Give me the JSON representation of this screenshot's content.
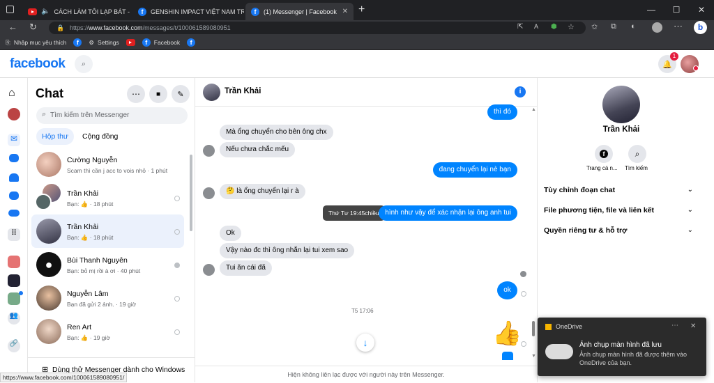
{
  "browser": {
    "tabs": [
      {
        "title": "CÁCH LÀM TÔI LẠP BÁT - N",
        "icon": "youtube-icon"
      },
      {
        "title": "GENSHIN IMPACT VIỆT NAM TR...",
        "icon": "facebook-icon"
      },
      {
        "title": "(1) Messenger | Facebook",
        "icon": "facebook-icon"
      }
    ],
    "url_prefix": "https://",
    "url_domain": "www.facebook.com",
    "url_path": "/messages/t/100061589080951",
    "bookmarks": [
      "Nhập mục yêu thích",
      "Settings",
      "Facebook"
    ]
  },
  "header": {
    "logo": "facebook",
    "notif_count": "1"
  },
  "chat": {
    "title": "Chat",
    "search_placeholder": "Tìm kiếm trên Messenger",
    "tabs": [
      "Hộp thư",
      "Cộng đồng"
    ],
    "conversations": [
      {
        "name": "Cường Nguyễn",
        "preview": "Scam thì cần j acc to vois nhỏ · 1 phút"
      },
      {
        "name": "Trần Khải",
        "preview": "Bạn: 👍 · 18 phút"
      },
      {
        "name": "Trần Khải",
        "preview": "Bạn: 👍 · 18 phút"
      },
      {
        "name": "Bùi Thanh Nguyên",
        "preview": "Bạn: bỏ mị rồi à ơi · 40 phút"
      },
      {
        "name": "Nguyễn Lâm",
        "preview": "Bạn đã gửi 2 ảnh. · 19 giờ"
      },
      {
        "name": "Ren Art",
        "preview": "Bạn: 👍 · 19 giờ"
      }
    ],
    "windows_promo": "Dùng thử Messenger dành cho Windows"
  },
  "conversation": {
    "name": "Trần Khải",
    "messages": [
      {
        "text": "thì đó",
        "dir": "out"
      },
      {
        "text": "Mà ổng chuyển cho bên ông chx",
        "dir": "in"
      },
      {
        "text": "Nếu chưa chắc mếu",
        "dir": "in"
      },
      {
        "text": "đang chuyển lại nè bạn",
        "dir": "out"
      },
      {
        "text": "🤔 là ổng chuyển lại r à",
        "dir": "in"
      },
      {
        "text": "hình như vậy để xác nhận lại ông anh tui",
        "dir": "out"
      },
      {
        "text": "Ok",
        "dir": "in"
      },
      {
        "text": "Vậy nào đc thì ông nhắn lại tui xem sao",
        "dir": "in"
      },
      {
        "text": "Tui ăn cái đã",
        "dir": "in"
      },
      {
        "text": "ok",
        "dir": "out"
      }
    ],
    "tooltip": "Thứ Tư 19:45chiều",
    "timestamp": "T5 17:06",
    "notice": "Hiện không liên lạc được với người này trên Messenger."
  },
  "profile": {
    "name": "Trần Khải",
    "actions": [
      "Trang cá n...",
      "Tìm kiếm"
    ],
    "options": [
      "Tùy chỉnh đoạn chat",
      "File phương tiện, file và liên kết",
      "Quyền riêng tư & hỗ trợ"
    ]
  },
  "toast": {
    "app": "OneDrive",
    "title": "Ảnh chụp màn hình đã lưu",
    "body": "Ảnh chụp màn hình đã được thêm vào OneDrive của bạn."
  },
  "status_url": "https://www.facebook.com/100061589080951/"
}
